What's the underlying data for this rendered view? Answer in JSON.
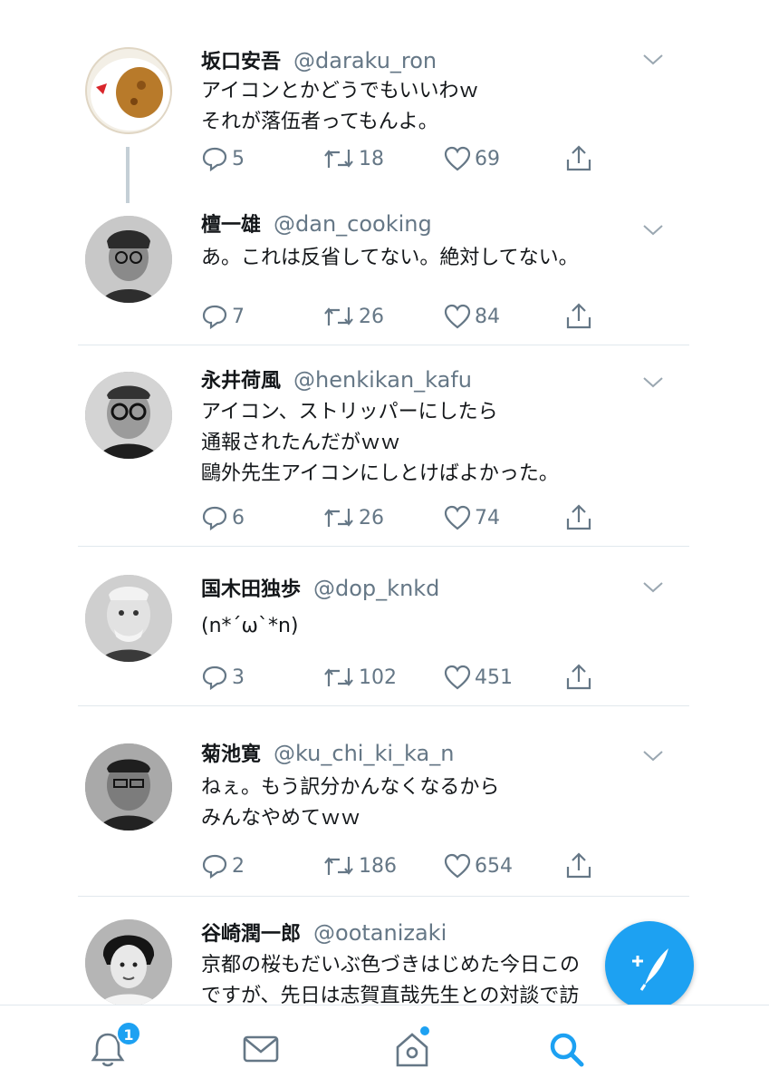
{
  "tweets": [
    {
      "name": "坂口安吾",
      "handle": "@daraku_ron",
      "text": "アイコンとかどうでもいいわｗ\nそれが落伍者ってもんよ。",
      "replies": "5",
      "retweets": "18",
      "likes": "69"
    },
    {
      "name": "檀一雄",
      "handle": "@dan_cooking",
      "text": "あ。これは反省してない。絶対してない。",
      "replies": "7",
      "retweets": "26",
      "likes": "84"
    },
    {
      "name": "永井荷風",
      "handle": "@henkikan_kafu",
      "text": "アイコン、ストリッパーにしたら\n通報されたんだがｗｗ\n鷗外先生アイコンにしとけばよかった。",
      "replies": "6",
      "retweets": "26",
      "likes": "74"
    },
    {
      "name": "国木田独歩",
      "handle": "@dop_knkd",
      "text": "(n*´ω`*n)",
      "replies": "3",
      "retweets": "102",
      "likes": "451"
    },
    {
      "name": "菊池寛",
      "handle": "@ku_chi_ki_ka_n",
      "text": "ねぇ。もう訳分かんなくなるから\nみんなやめてｗｗ",
      "replies": "2",
      "retweets": "186",
      "likes": "654"
    },
    {
      "name": "谷崎潤一郎",
      "handle": "@ootanizaki",
      "text": "京都の桜もだいぶ色づきはじめた今日この\nですが、先日は志賀直哉先生との対談で訪"
    }
  ],
  "tabbar": {
    "notifications_badge": "1",
    "icons": [
      "bell-icon",
      "mail-icon",
      "home-icon",
      "search-icon"
    ],
    "active_tab": "search"
  },
  "colors": {
    "accent": "#1da1f2",
    "secondary_text": "#657786",
    "divider": "#e1e8ed"
  }
}
